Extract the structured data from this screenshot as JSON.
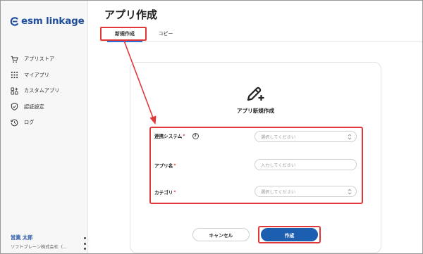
{
  "app": {
    "logo_text": "esm linkage",
    "page_title": "アプリ作成"
  },
  "sidebar": {
    "items": [
      {
        "label": "アプリストア",
        "icon": "cart-icon"
      },
      {
        "label": "マイアプリ",
        "icon": "grid-dots-icon"
      },
      {
        "label": "カスタムアプリ",
        "icon": "apps-plus-icon"
      },
      {
        "label": "認証設定",
        "icon": "shield-icon"
      },
      {
        "label": "ログ",
        "icon": "history-icon"
      }
    ]
  },
  "user": {
    "name": "営業 太郎",
    "org": "ソフトブレーン株式会社（..."
  },
  "tabs": {
    "new": "新規作成",
    "copy": "コピー"
  },
  "card": {
    "title": "アプリ新規作成",
    "fields": {
      "system": {
        "label": "連携システム",
        "required": "*",
        "help": "?",
        "placeholder": "選択してください"
      },
      "name": {
        "label": "アプリ名",
        "required": "*",
        "placeholder": "入力してください"
      },
      "category": {
        "label": "カテゴリ",
        "required": "*",
        "placeholder": "選択してください"
      }
    }
  },
  "buttons": {
    "cancel": "キャンセル",
    "create": "作成"
  },
  "colors": {
    "brand": "#1f4f9c",
    "primary": "#1c5fb0",
    "annotation": "#e0383a",
    "tab_underline": "#2a6fd6"
  }
}
